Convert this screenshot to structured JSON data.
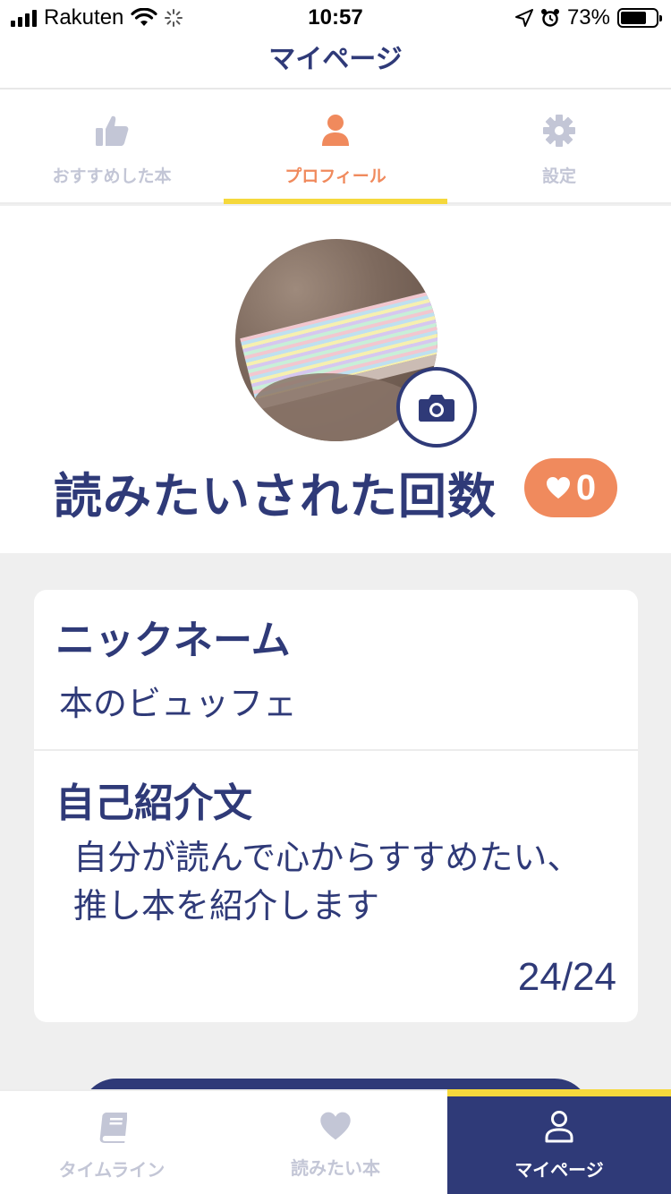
{
  "status_bar": {
    "carrier": "Rakuten",
    "time": "10:57",
    "battery": "73%",
    "battery_level": 0.73
  },
  "nav": {
    "title": "マイページ"
  },
  "top_tabs": [
    {
      "label": "おすすめした本",
      "icon": "thumbs-up-icon",
      "active": false
    },
    {
      "label": "プロフィール",
      "icon": "person-icon",
      "active": true
    },
    {
      "label": "設定",
      "icon": "gear-icon",
      "active": false
    }
  ],
  "profile": {
    "want_count_label": "読みたいされた回数",
    "want_count": "0"
  },
  "card": {
    "nickname_label": "ニックネーム",
    "nickname": "本のビュッフェ",
    "bio_label": "自己紹介文",
    "bio": "自分が読んで心からすすめたい、推し本を紹介します",
    "char_count": "24/24"
  },
  "bottom_tabs": [
    {
      "label": "タイムライン",
      "icon": "book-icon",
      "active": false
    },
    {
      "label": "読みたい本",
      "icon": "heart-icon",
      "active": false
    },
    {
      "label": "マイページ",
      "icon": "person-outline-icon",
      "active": true
    }
  ],
  "colors": {
    "primary": "#2f3a78",
    "accent": "#f08a5d",
    "highlight": "#f5d83c",
    "inactive": "#c3c6d6"
  }
}
